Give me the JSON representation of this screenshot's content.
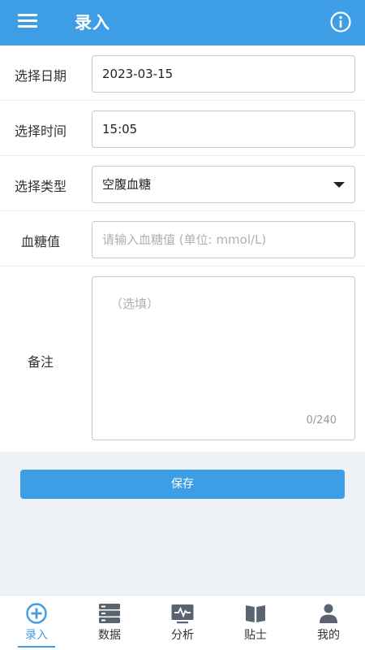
{
  "header": {
    "title": "录入",
    "menu_icon": "menu-icon",
    "info_icon": "info-icon"
  },
  "form": {
    "date": {
      "label": "选择日期",
      "value": "2023-03-15"
    },
    "time": {
      "label": "选择时间",
      "value": "15:05"
    },
    "type": {
      "label": "选择类型",
      "value": "空腹血糖"
    },
    "glucose": {
      "label": "血糖值",
      "placeholder": "请输入血糖值 (单位: mmol/L)"
    },
    "note": {
      "label": "备注",
      "placeholder": "（选填）",
      "counter": "0/240"
    }
  },
  "save_button": {
    "label": "保存"
  },
  "tabbar": {
    "items": [
      {
        "label": "录入",
        "icon": "plus-circle-icon",
        "active": true
      },
      {
        "label": "数据",
        "icon": "database-icon",
        "active": false
      },
      {
        "label": "分析",
        "icon": "chart-monitor-icon",
        "active": false
      },
      {
        "label": "贴士",
        "icon": "book-icon",
        "active": false
      },
      {
        "label": "我的",
        "icon": "user-icon",
        "active": false
      }
    ]
  },
  "colors": {
    "primary": "#3e9ee5",
    "background": "#eef2f6",
    "icon_gray": "#5a6470"
  }
}
